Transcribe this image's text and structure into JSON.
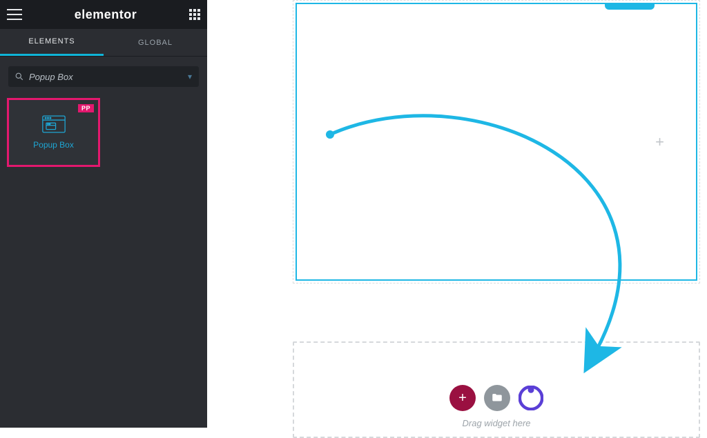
{
  "brand": "elementor",
  "tabs": {
    "elements": "ELEMENTS",
    "global": "GLOBAL"
  },
  "search": {
    "value": "Popup Box"
  },
  "widget": {
    "badge": "PP",
    "label": "Popup Box"
  },
  "canvas": {
    "plus_glyph": "+"
  },
  "dropzone": {
    "add_glyph": "+",
    "hint": "Drag widget here"
  },
  "colors": {
    "accent": "#1eb7e5",
    "highlight_border": "#e3186e",
    "btn_add": "#9a1041",
    "btn_folder": "#8f969c",
    "pp_purple": "#5a3fd6"
  }
}
